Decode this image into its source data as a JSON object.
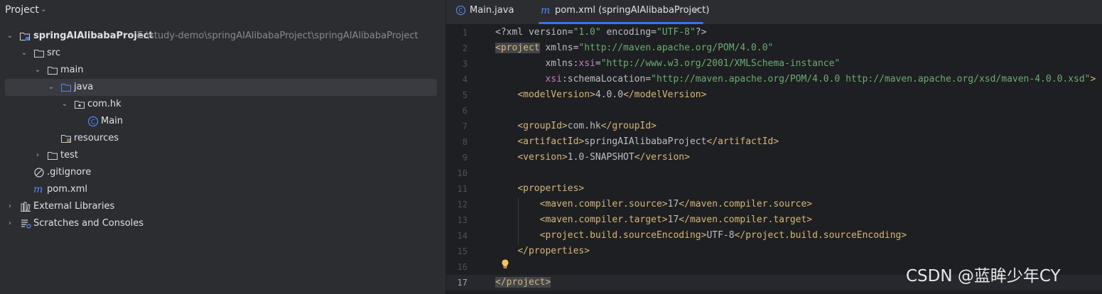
{
  "project_panel": {
    "title": "Project",
    "tree": [
      {
        "label": "springAIAlibabaProject",
        "path": "E:\\study-demo\\springAIAlibabaProject\\springAIAlibabaProject"
      },
      {
        "label": "src"
      },
      {
        "label": "main"
      },
      {
        "label": "java"
      },
      {
        "label": "com.hk"
      },
      {
        "label": "Main"
      },
      {
        "label": "resources"
      },
      {
        "label": "test"
      },
      {
        "label": ".gitignore"
      },
      {
        "label": "pom.xml"
      },
      {
        "label": "External Libraries"
      },
      {
        "label": "Scratches and Consoles"
      }
    ]
  },
  "editor": {
    "tabs": [
      {
        "label": "Main.java",
        "icon": "class-icon"
      },
      {
        "label": "pom.xml (springAIAlibabaProject)",
        "icon": "maven-icon",
        "close": "×"
      }
    ],
    "line_numbers": [
      "1",
      "2",
      "3",
      "4",
      "5",
      "6",
      "7",
      "8",
      "9",
      "10",
      "11",
      "12",
      "13",
      "14",
      "15",
      "16",
      "17"
    ],
    "current_line": 17
  },
  "code": {
    "l1": {
      "a": "<?xml version=",
      "b": "\"1.0\"",
      "c": " encoding=",
      "d": "\"UTF-8\"",
      "e": "?>"
    },
    "l2": {
      "a": "<project",
      "b": " xmlns=",
      "c": "\"http://maven.apache.org/POM/4.0.0\""
    },
    "l3": {
      "a": "         xmlns:",
      "b": "xsi",
      "c": "=",
      "d": "\"http://www.w3.org/2001/XMLSchema-instance\""
    },
    "l4": {
      "a": "         ",
      "b": "xsi",
      "c": ":schemaLocation=",
      "d": "\"http://maven.apache.org/POM/4.0.0 http://maven.apache.org/xsd/maven-4.0.0.xsd\"",
      "e": ">"
    },
    "l5": {
      "a": "    ",
      "b": "<modelVersion>",
      "c": "4.0.0",
      "d": "</modelVersion>"
    },
    "l7": {
      "a": "    ",
      "b": "<groupId>",
      "c": "com.hk",
      "d": "</groupId>"
    },
    "l8": {
      "a": "    ",
      "b": "<artifactId>",
      "c": "springAIAlibabaProject",
      "d": "</artifactId>"
    },
    "l9": {
      "a": "    ",
      "b": "<version>",
      "c": "1.0-SNAPSHOT",
      "d": "</version>"
    },
    "l11": {
      "a": "    ",
      "b": "<properties>"
    },
    "l12": {
      "a": "        ",
      "b": "<maven.compiler.source>",
      "c": "17",
      "d": "</maven.compiler.source>"
    },
    "l13": {
      "a": "        ",
      "b": "<maven.compiler.target>",
      "c": "17",
      "d": "</maven.compiler.target>"
    },
    "l14": {
      "a": "        ",
      "b": "<project.build.sourceEncoding>",
      "c": "UTF-8",
      "d": "</project.build.sourceEncoding>"
    },
    "l15": {
      "a": "    ",
      "b": "</properties>"
    },
    "l17": {
      "a": "</project>"
    }
  },
  "watermark": "CSDN @蓝眸少年CY",
  "colors": {
    "accent": "#3574f0",
    "tag": "#d5b778",
    "string": "#6aab73",
    "namespace": "#c77dbb"
  }
}
